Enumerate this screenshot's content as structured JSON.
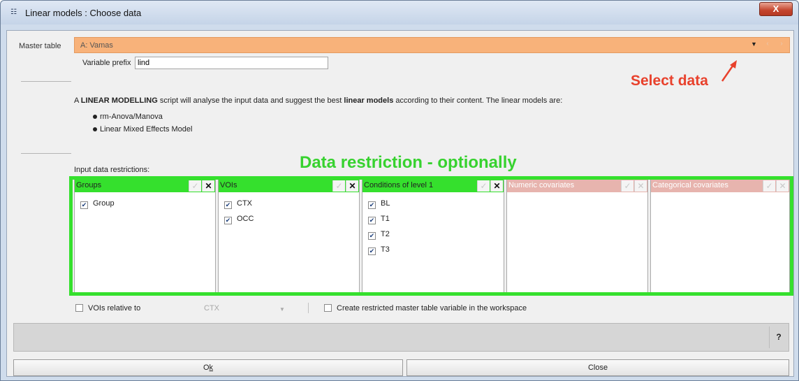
{
  "window": {
    "title": "Linear models : Choose data",
    "icon": "table-app-icon",
    "close_label": "X"
  },
  "master": {
    "label": "Master table",
    "value": "A:  Vamas"
  },
  "prefix": {
    "label": "Variable prefix",
    "value": "lind"
  },
  "annotations": {
    "select_data": "Select data",
    "data_restriction": "Data restriction - optionally"
  },
  "intro": {
    "part1": "A ",
    "bold1": "LINEAR MODELLING",
    "part2": " script will analyse the input data and suggest the best ",
    "bold2": "linear models",
    "part3": " according to their content. The linear models are:",
    "bullets": [
      "rm-Anova/Manova",
      "Linear Mixed Effects Model"
    ]
  },
  "restrictions": {
    "label": "Input data restrictions:",
    "panels": [
      {
        "title": "Groups",
        "items": [
          "Group"
        ],
        "active": true,
        "header_color": "#35e02d"
      },
      {
        "title": "VOIs",
        "items": [
          "CTX",
          "OCC"
        ],
        "active": true,
        "header_color": "#35e02d"
      },
      {
        "title": "Conditions of level 1",
        "items": [
          "BL",
          "T1",
          "T2",
          "T3"
        ],
        "active": true,
        "header_color": "#35e02d"
      },
      {
        "title": "Numeric covariates",
        "items": [],
        "active": false,
        "header_color": "#e7b4ae"
      },
      {
        "title": "Categorical covariates",
        "items": [],
        "active": false,
        "header_color": "#e7b4ae"
      }
    ]
  },
  "options": {
    "vois_relative_label": "VOIs relative to",
    "vois_relative_value": "CTX",
    "create_restricted_label": "Create restricted master table variable in the workspace"
  },
  "help_label": "?",
  "buttons": {
    "ok_prefix": "O",
    "ok_underlined": "k",
    "close": "Close"
  },
  "icons": {
    "check": "✓",
    "x": "✕",
    "checkbox_mark": "✔",
    "dropdown": "▼",
    "arrow": "↗"
  }
}
